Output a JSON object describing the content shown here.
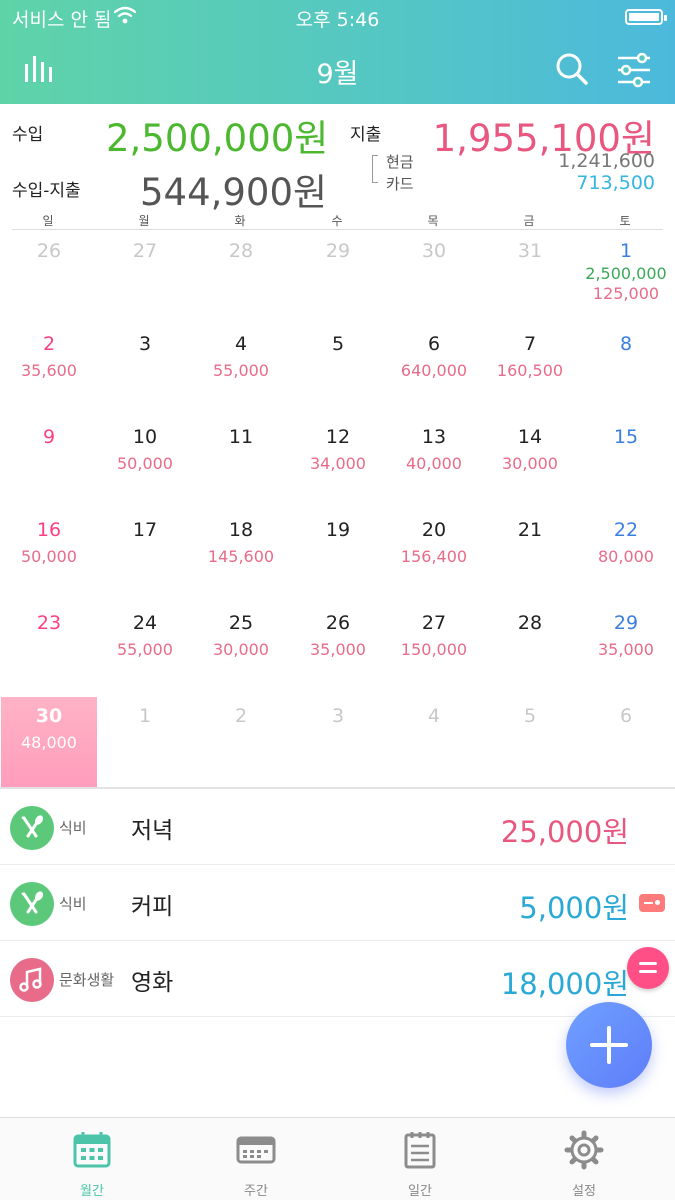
{
  "status_bar": {
    "carrier": "서비스 안 됨",
    "time": "오후 5:46"
  },
  "nav": {
    "title": "9월",
    "left_icon": "chart-bars-icon",
    "search_icon": "search-icon",
    "filter_icon": "filter-sliders-icon"
  },
  "summary": {
    "income_label": "수입",
    "income_value": "2,500,000원",
    "expense_label": "지출",
    "expense_value": "1,955,100원",
    "balance_label": "수입-지출",
    "balance_value": "544,900원",
    "cash_label": "현금",
    "cash_value": "1,241,600",
    "card_label": "카드",
    "card_value": "713,500"
  },
  "calendar": {
    "weekdays": [
      "일",
      "월",
      "화",
      "수",
      "목",
      "금",
      "토"
    ],
    "weeks": [
      [
        {
          "d": "26",
          "dim": true
        },
        {
          "d": "27",
          "dim": true
        },
        {
          "d": "28",
          "dim": true
        },
        {
          "d": "29",
          "dim": true
        },
        {
          "d": "30",
          "dim": true
        },
        {
          "d": "31",
          "dim": true
        },
        {
          "d": "1",
          "inc": "2,500,000",
          "exp": "125,000"
        }
      ],
      [
        {
          "d": "2",
          "exp": "35,600"
        },
        {
          "d": "3"
        },
        {
          "d": "4",
          "exp": "55,000"
        },
        {
          "d": "5"
        },
        {
          "d": "6",
          "exp": "640,000"
        },
        {
          "d": "7",
          "exp": "160,500"
        },
        {
          "d": "8"
        }
      ],
      [
        {
          "d": "9"
        },
        {
          "d": "10",
          "exp": "50,000"
        },
        {
          "d": "11"
        },
        {
          "d": "12",
          "exp": "34,000"
        },
        {
          "d": "13",
          "exp": "40,000"
        },
        {
          "d": "14",
          "exp": "30,000"
        },
        {
          "d": "15"
        }
      ],
      [
        {
          "d": "16",
          "exp": "50,000"
        },
        {
          "d": "17"
        },
        {
          "d": "18",
          "exp": "145,600"
        },
        {
          "d": "19"
        },
        {
          "d": "20",
          "exp": "156,400"
        },
        {
          "d": "21"
        },
        {
          "d": "22",
          "exp": "80,000"
        }
      ],
      [
        {
          "d": "23"
        },
        {
          "d": "24",
          "exp": "55,000"
        },
        {
          "d": "25",
          "exp": "30,000"
        },
        {
          "d": "26",
          "exp": "35,000"
        },
        {
          "d": "27",
          "exp": "150,000"
        },
        {
          "d": "28"
        },
        {
          "d": "29",
          "exp": "35,000"
        }
      ],
      [
        {
          "d": "30",
          "exp": "48,000",
          "today": true
        },
        {
          "d": "1",
          "dim": true
        },
        {
          "d": "2",
          "dim": true
        },
        {
          "d": "3",
          "dim": true
        },
        {
          "d": "4",
          "dim": true
        },
        {
          "d": "5",
          "dim": true
        },
        {
          "d": "6",
          "dim": true
        }
      ]
    ]
  },
  "transactions": [
    {
      "category": "식비",
      "icon": "fork-knife-icon",
      "desc": "저녁",
      "amount": "25,000원",
      "amount_color": "#e8577f",
      "icon_color": "#5cc97a",
      "card": false
    },
    {
      "category": "식비",
      "icon": "fork-knife-icon",
      "desc": "커피",
      "amount": "5,000원",
      "amount_color": "#2aa9d6",
      "icon_color": "#5cc97a",
      "card": true
    },
    {
      "category": "문화생활",
      "icon": "music-note-icon",
      "desc": "영화",
      "amount": "18,000원",
      "amount_color": "#2aa9d6",
      "icon_color": "#e86b8a",
      "card": false
    }
  ],
  "tabs": [
    {
      "label": "월간",
      "icon": "calendar-month-icon",
      "active": true
    },
    {
      "label": "주간",
      "icon": "calendar-week-icon",
      "active": false
    },
    {
      "label": "일간",
      "icon": "notepad-icon",
      "active": false
    },
    {
      "label": "설정",
      "icon": "gear-icon",
      "active": false
    }
  ],
  "colors": {
    "header_gradient": [
      "#5fd3a8",
      "#4cb9dc"
    ],
    "income": "#4cb82f",
    "expense": "#e8577f",
    "balance": "#555555",
    "fab": "#5f7dfa"
  }
}
